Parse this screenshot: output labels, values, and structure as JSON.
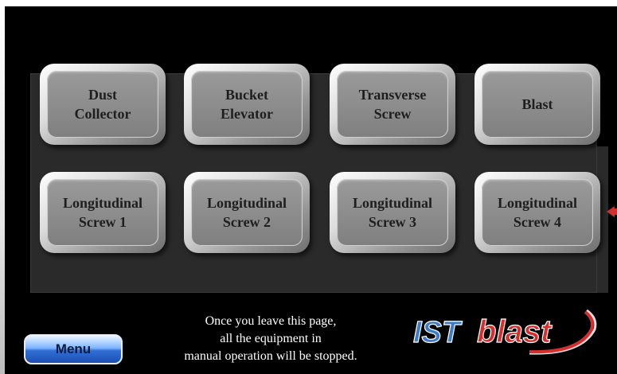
{
  "buttons": {
    "row1": [
      {
        "label": "Dust\nCollector"
      },
      {
        "label": "Bucket\nElevator"
      },
      {
        "label": "Transverse\nScrew"
      },
      {
        "label": "Blast"
      }
    ],
    "row2": [
      {
        "label": "Longitudinal\nScrew 1"
      },
      {
        "label": "Longitudinal\nScrew 2"
      },
      {
        "label": "Longitudinal\nScrew 3"
      },
      {
        "label": "Longitudinal\nScrew 4"
      }
    ]
  },
  "menu": {
    "label": "Menu"
  },
  "message": "Once you leave this page,\nall the equipment in\nmanual operation will be stopped.",
  "logo": {
    "text_ist": "IST",
    "text_blast": "blast"
  },
  "colors": {
    "accent": "#d62d2d",
    "menu_blue": "#2f6fd8",
    "panel": "#2a2a2a"
  }
}
